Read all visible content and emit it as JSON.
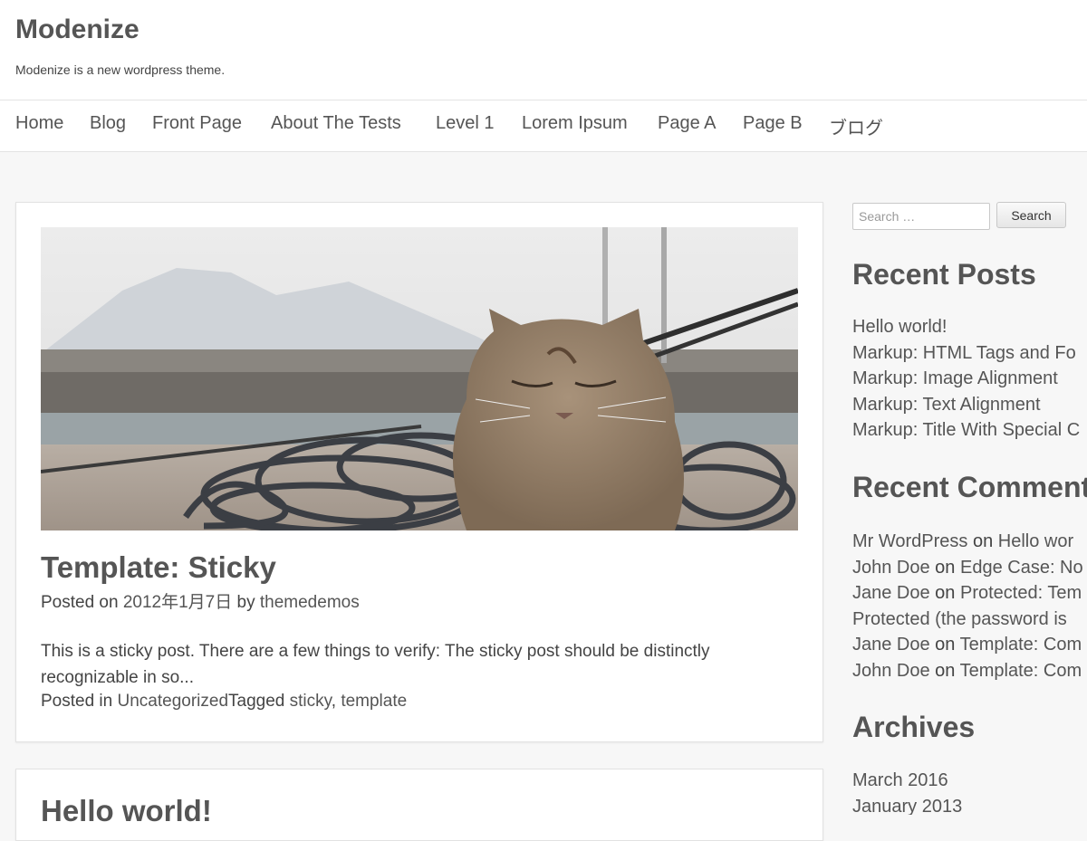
{
  "site": {
    "title": "Modenize",
    "description": "Modenize is a new wordpress theme."
  },
  "nav": {
    "items": [
      {
        "label": "Home"
      },
      {
        "label": "Blog"
      },
      {
        "label": "Front Page"
      },
      {
        "label": "About The Tests"
      },
      {
        "label": "Level 1"
      },
      {
        "label": "Lorem Ipsum"
      },
      {
        "label": "Page A"
      },
      {
        "label": "Page B"
      },
      {
        "label": "ブログ"
      }
    ]
  },
  "posts": [
    {
      "title": "Template: Sticky",
      "posted_on_prefix": "Posted on ",
      "date": "2012年1月7日",
      "by": " by ",
      "author": "themedemos",
      "excerpt": "This is a sticky post. There are a few things to verify: The sticky post should be distinctly recognizable in so...",
      "posted_in_prefix": "Posted in ",
      "category": "Uncategorized",
      "tagged_prefix": "Tagged ",
      "tag1": "sticky",
      "tag_sep": ", ",
      "tag2": "template"
    },
    {
      "title": "Hello world!"
    }
  ],
  "sidebar": {
    "search": {
      "placeholder": "Search …",
      "button": "Search"
    },
    "recent_posts": {
      "title": "Recent Posts",
      "items": [
        "Hello world!",
        "Markup: HTML Tags and Fo",
        "Markup: Image Alignment",
        "Markup: Text Alignment",
        "Markup: Title With Special C"
      ]
    },
    "recent_comments": {
      "title": "Recent Comments",
      "on": " on ",
      "items": [
        {
          "author": "Mr WordPress",
          "post": "Hello wor"
        },
        {
          "author": "John Doe",
          "post": "Edge Case: No"
        },
        {
          "author": "Jane Doe",
          "post": "Protected: Tem"
        },
        {
          "author": "",
          "post": "Protected (the password is"
        },
        {
          "author": "Jane Doe",
          "post": "Template: Com"
        },
        {
          "author": "John Doe",
          "post": "Template: Com"
        }
      ]
    },
    "archives": {
      "title": "Archives",
      "items": [
        "March 2016",
        "January 2013"
      ]
    }
  }
}
